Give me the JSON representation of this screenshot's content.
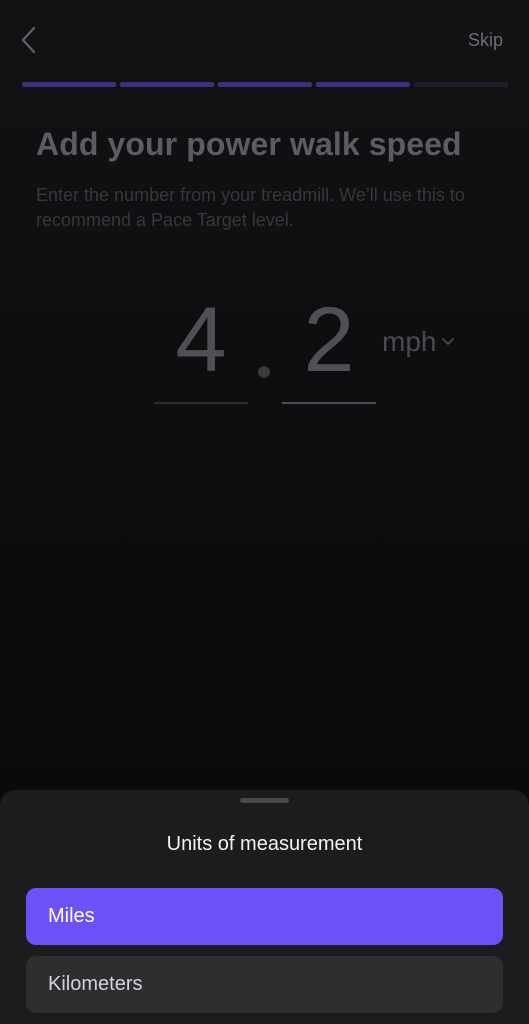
{
  "header": {
    "back_icon": "chevron-left-icon",
    "skip_label": "Skip"
  },
  "progress": {
    "total_steps": 5,
    "completed_steps": 4,
    "active_color": "#3a3180"
  },
  "main": {
    "title": "Add your power walk speed",
    "subtitle": "Enter the number from your treadmill. We’ll use this to recommend a Pace Target level.",
    "speed": {
      "integer_part": "4",
      "decimal_part": "2",
      "unit": "mph",
      "unit_icon": "chevron-down-icon"
    }
  },
  "sheet": {
    "title": "Units of measurement",
    "options": [
      {
        "label": "Miles",
        "selected": true
      },
      {
        "label": "Kilometers",
        "selected": false
      }
    ],
    "selected_color": "#6b52f7"
  }
}
